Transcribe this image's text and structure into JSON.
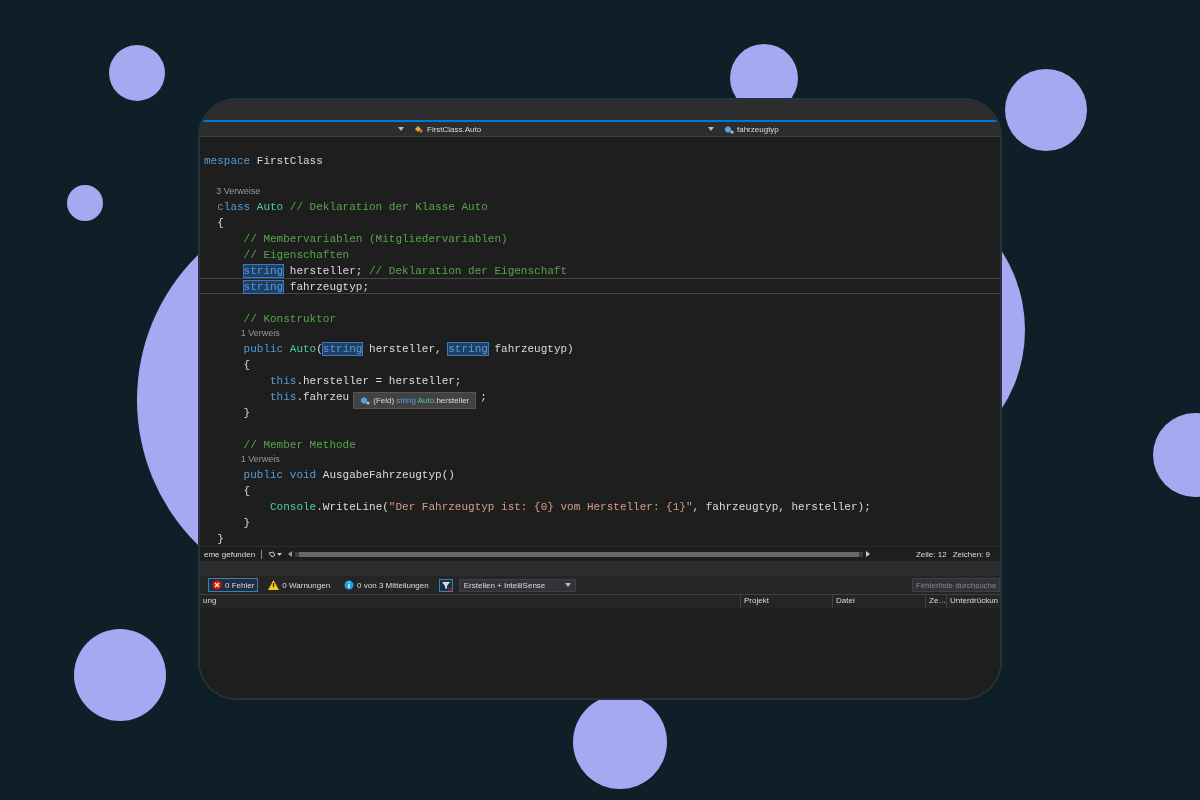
{
  "navigation": [
    {
      "label": "FirstClass.Auto",
      "kind": "class"
    },
    {
      "label": "fahrzeugtyp",
      "kind": "field"
    }
  ],
  "editor": {
    "lines": [
      {
        "kind": "code",
        "current": false,
        "tokens": [
          {
            "kind": "kw",
            "text": "mespace "
          },
          {
            "kind": "text",
            "text": "FirstClass"
          }
        ],
        "children": [
          {
            "kind": "blank",
            "current": false
          },
          {
            "kind": "lens",
            "current": false,
            "text": "3 Verweise"
          },
          {
            "kind": "code",
            "current": false,
            "tokens": [
              {
                "kind": "kw",
                "text": "class "
              },
              {
                "kind": "type",
                "text": "Auto"
              },
              {
                "kind": "comment",
                "text": " // Deklaration der Klasse Auto"
              }
            ]
          },
          {
            "kind": "code",
            "current": false,
            "tokens": [
              {
                "kind": "text",
                "text": "{"
              }
            ],
            "children": [
              {
                "kind": "code",
                "current": false,
                "tokens": [
                  {
                    "kind": "comment",
                    "text": "// Membervariablen (Mitgliedervariablen)"
                  }
                ]
              },
              {
                "kind": "code",
                "current": false,
                "tokens": [
                  {
                    "kind": "comment",
                    "text": "// Eigenschaften"
                  }
                ]
              },
              {
                "kind": "code",
                "current": false,
                "tokens": [
                  {
                    "kind": "ref",
                    "text": "string"
                  },
                  {
                    "kind": "text",
                    "text": " hersteller;"
                  },
                  {
                    "kind": "comment",
                    "text": " // Deklaration der Eigenschaft"
                  }
                ]
              },
              {
                "kind": "code",
                "current": true,
                "tokens": [
                  {
                    "kind": "ref",
                    "text": "string"
                  },
                  {
                    "kind": "text",
                    "text": " fahrzeugtyp;"
                  }
                ]
              },
              {
                "kind": "blank",
                "current": false
              },
              {
                "kind": "code",
                "current": false,
                "tokens": [
                  {
                    "kind": "comment",
                    "text": "// Konstruktor"
                  }
                ]
              },
              {
                "kind": "lens",
                "current": false,
                "text": "1 Verweis"
              },
              {
                "kind": "code",
                "current": false,
                "tokens": [
                  {
                    "kind": "kw",
                    "text": "public "
                  },
                  {
                    "kind": "type",
                    "text": "Auto"
                  },
                  {
                    "kind": "text",
                    "text": "("
                  },
                  {
                    "kind": "ref",
                    "text": "string"
                  },
                  {
                    "kind": "text",
                    "text": " hersteller, "
                  },
                  {
                    "kind": "ref",
                    "text": "string"
                  },
                  {
                    "kind": "text",
                    "text": " fahrzeugtyp)"
                  }
                ]
              },
              {
                "kind": "code",
                "current": false,
                "tokens": [
                  {
                    "kind": "text",
                    "text": "{"
                  }
                ],
                "children": [
                  {
                    "kind": "code",
                    "current": false,
                    "tokens": [
                      {
                        "kind": "kw",
                        "text": "this"
                      },
                      {
                        "kind": "text",
                        "text": ".hersteller = hersteller;"
                      }
                    ]
                  },
                  {
                    "kind": "code",
                    "current": false,
                    "tokens": [
                      {
                        "kind": "kw",
                        "text": "this"
                      },
                      {
                        "kind": "text",
                        "text": ".fahrzeu"
                      },
                      {
                        "kind": "tooltip",
                        "parts": [
                          {
                            "kind": "text",
                            "text": "(Feld) "
                          },
                          {
                            "kind": "kw",
                            "text": "string"
                          },
                          {
                            "kind": "type",
                            "text": " Auto"
                          },
                          {
                            "kind": "text",
                            "text": ".hersteller"
                          }
                        ]
                      },
                      {
                        "kind": "text",
                        "text": ";"
                      }
                    ]
                  }
                ]
              },
              {
                "kind": "code",
                "current": false,
                "tokens": [
                  {
                    "kind": "text",
                    "text": "}"
                  }
                ]
              },
              {
                "kind": "blank",
                "current": false
              },
              {
                "kind": "code",
                "current": false,
                "tokens": [
                  {
                    "kind": "comment",
                    "text": "// Member Methode"
                  }
                ]
              },
              {
                "kind": "lens",
                "current": false,
                "text": "1 Verweis"
              },
              {
                "kind": "code",
                "current": false,
                "tokens": [
                  {
                    "kind": "kw",
                    "text": "public void "
                  },
                  {
                    "kind": "text",
                    "text": "AusgabeFahrzeugtyp()"
                  }
                ]
              },
              {
                "kind": "code",
                "current": false,
                "tokens": [
                  {
                    "kind": "text",
                    "text": "{"
                  }
                ],
                "children": [
                  {
                    "kind": "code",
                    "current": false,
                    "tokens": [
                      {
                        "kind": "type",
                        "text": "Console"
                      },
                      {
                        "kind": "text",
                        "text": ".WriteLine("
                      },
                      {
                        "kind": "str",
                        "text": "\"Der Fahrzeugtyp ist: {0} vom Hersteller: {1}\""
                      },
                      {
                        "kind": "text",
                        "text": ", fahrzeugtyp, hersteller);"
                      }
                    ]
                  }
                ]
              },
              {
                "kind": "code",
                "current": false,
                "tokens": [
                  {
                    "kind": "text",
                    "text": "}"
                  }
                ]
              }
            ]
          },
          {
            "kind": "code",
            "current": false,
            "tokens": [
              {
                "kind": "text",
                "text": "}"
              }
            ]
          }
        ]
      }
    ]
  },
  "status_bar": {
    "issues": "eme gefunden",
    "line": "Zeile: 12",
    "column": "Zeichen: 9"
  },
  "error_list": {
    "filters": [
      {
        "kind": "error",
        "label": "0 Fehler",
        "selected": true
      },
      {
        "kind": "warning",
        "label": "0 Warnungen",
        "selected": false
      },
      {
        "kind": "info",
        "label": "0 von 3 Mitteilungen",
        "selected": false
      }
    ],
    "scope": "Erstellen + IntelliSense",
    "search": {
      "placeholder": "Fehlerliste durchsuche"
    },
    "columns": [
      "ung",
      "Projekt",
      "Datei",
      "Ze…",
      "Unterdrückun"
    ]
  }
}
